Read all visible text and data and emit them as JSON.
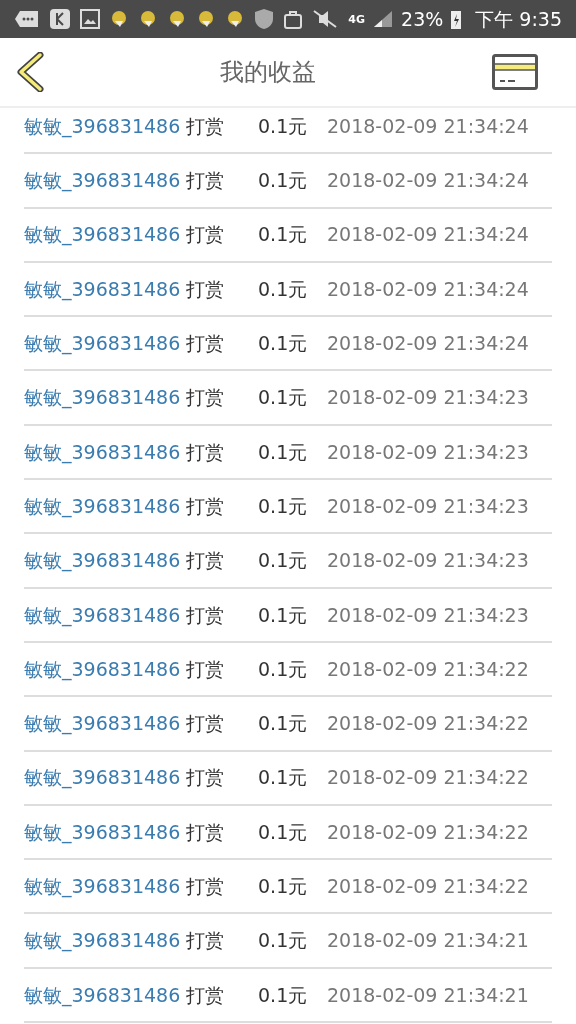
{
  "status_bar": {
    "network": "4G",
    "battery": "23%",
    "time": "下午 9:35"
  },
  "header": {
    "title": "我的收益"
  },
  "records": [
    {
      "user": "敏敏_396831486",
      "action": "打赏",
      "amount": "0.1元",
      "time": "2018-02-09 21:34:24"
    },
    {
      "user": "敏敏_396831486",
      "action": "打赏",
      "amount": "0.1元",
      "time": "2018-02-09 21:34:24"
    },
    {
      "user": "敏敏_396831486",
      "action": "打赏",
      "amount": "0.1元",
      "time": "2018-02-09 21:34:24"
    },
    {
      "user": "敏敏_396831486",
      "action": "打赏",
      "amount": "0.1元",
      "time": "2018-02-09 21:34:24"
    },
    {
      "user": "敏敏_396831486",
      "action": "打赏",
      "amount": "0.1元",
      "time": "2018-02-09 21:34:24"
    },
    {
      "user": "敏敏_396831486",
      "action": "打赏",
      "amount": "0.1元",
      "time": "2018-02-09 21:34:23"
    },
    {
      "user": "敏敏_396831486",
      "action": "打赏",
      "amount": "0.1元",
      "time": "2018-02-09 21:34:23"
    },
    {
      "user": "敏敏_396831486",
      "action": "打赏",
      "amount": "0.1元",
      "time": "2018-02-09 21:34:23"
    },
    {
      "user": "敏敏_396831486",
      "action": "打赏",
      "amount": "0.1元",
      "time": "2018-02-09 21:34:23"
    },
    {
      "user": "敏敏_396831486",
      "action": "打赏",
      "amount": "0.1元",
      "time": "2018-02-09 21:34:23"
    },
    {
      "user": "敏敏_396831486",
      "action": "打赏",
      "amount": "0.1元",
      "time": "2018-02-09 21:34:22"
    },
    {
      "user": "敏敏_396831486",
      "action": "打赏",
      "amount": "0.1元",
      "time": "2018-02-09 21:34:22"
    },
    {
      "user": "敏敏_396831486",
      "action": "打赏",
      "amount": "0.1元",
      "time": "2018-02-09 21:34:22"
    },
    {
      "user": "敏敏_396831486",
      "action": "打赏",
      "amount": "0.1元",
      "time": "2018-02-09 21:34:22"
    },
    {
      "user": "敏敏_396831486",
      "action": "打赏",
      "amount": "0.1元",
      "time": "2018-02-09 21:34:22"
    },
    {
      "user": "敏敏_396831486",
      "action": "打赏",
      "amount": "0.1元",
      "time": "2018-02-09 21:34:21"
    },
    {
      "user": "敏敏_396831486",
      "action": "打赏",
      "amount": "0.1元",
      "time": "2018-02-09 21:34:21"
    }
  ]
}
